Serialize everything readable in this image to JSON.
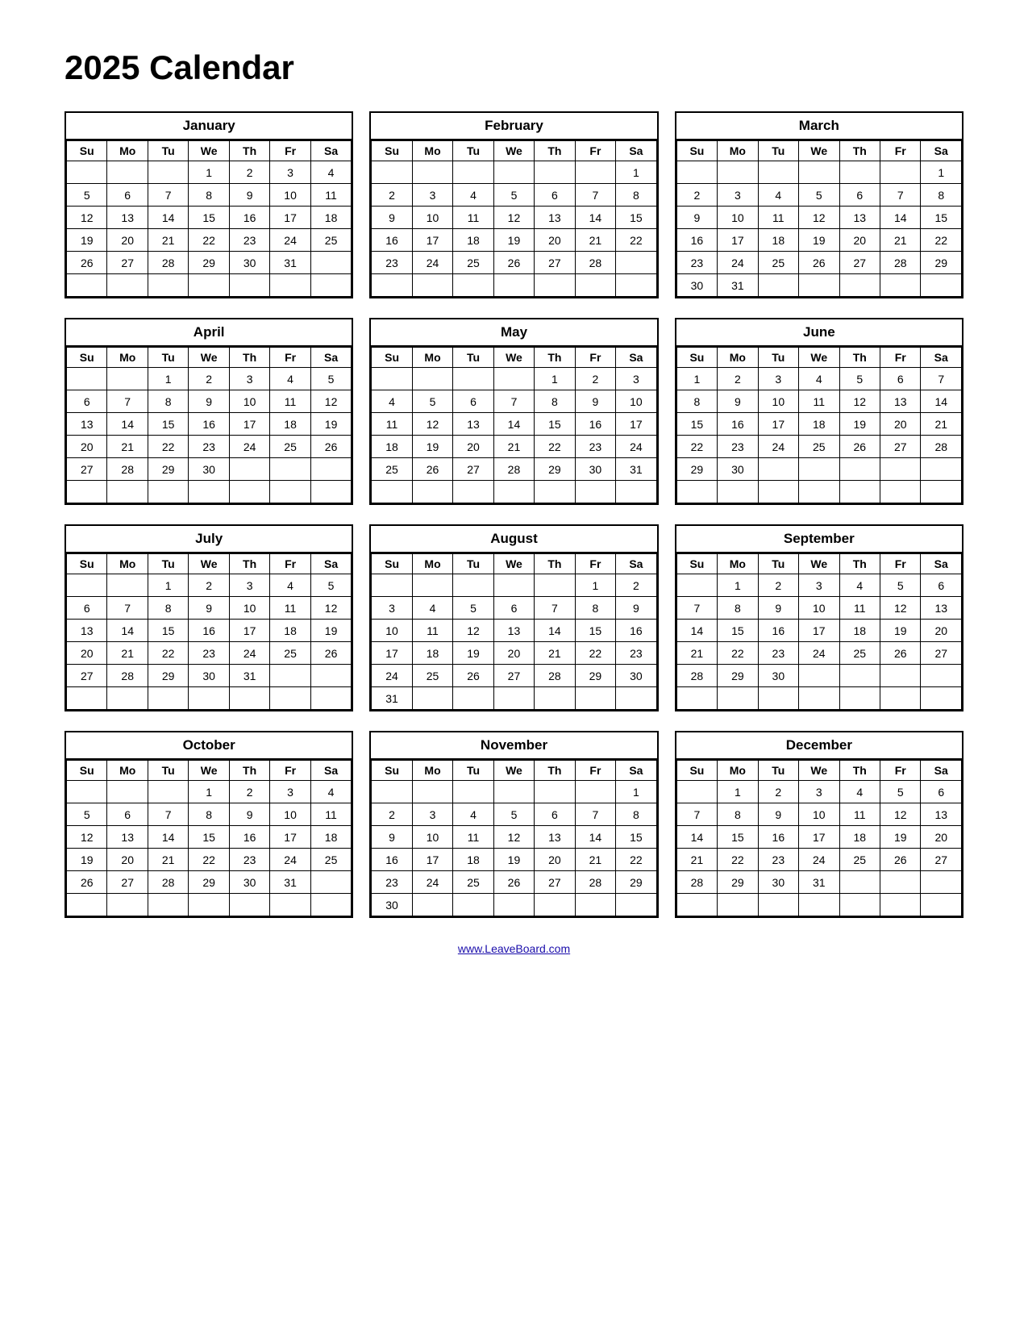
{
  "title": "2025 Calendar",
  "footer_link": "www.LeaveBoard.com",
  "months": [
    {
      "name": "January",
      "days": [
        "Su",
        "Mo",
        "Tu",
        "We",
        "Th",
        "Fr",
        "Sa"
      ],
      "weeks": [
        [
          "",
          "",
          "",
          "1",
          "2",
          "3",
          "4"
        ],
        [
          "5",
          "6",
          "7",
          "8",
          "9",
          "10",
          "11"
        ],
        [
          "12",
          "13",
          "14",
          "15",
          "16",
          "17",
          "18"
        ],
        [
          "19",
          "20",
          "21",
          "22",
          "23",
          "24",
          "25"
        ],
        [
          "26",
          "27",
          "28",
          "29",
          "30",
          "31",
          ""
        ],
        [
          "",
          "",
          "",
          "",
          "",
          "",
          ""
        ]
      ]
    },
    {
      "name": "February",
      "days": [
        "Su",
        "Mo",
        "Tu",
        "We",
        "Th",
        "Fr",
        "Sa"
      ],
      "weeks": [
        [
          "",
          "",
          "",
          "",
          "",
          "",
          "1"
        ],
        [
          "2",
          "3",
          "4",
          "5",
          "6",
          "7",
          "8"
        ],
        [
          "9",
          "10",
          "11",
          "12",
          "13",
          "14",
          "15"
        ],
        [
          "16",
          "17",
          "18",
          "19",
          "20",
          "21",
          "22"
        ],
        [
          "23",
          "24",
          "25",
          "26",
          "27",
          "28",
          ""
        ],
        [
          "",
          "",
          "",
          "",
          "",
          "",
          ""
        ]
      ]
    },
    {
      "name": "March",
      "days": [
        "Su",
        "Mo",
        "Tu",
        "We",
        "Th",
        "Fr",
        "Sa"
      ],
      "weeks": [
        [
          "",
          "",
          "",
          "",
          "",
          "",
          "1"
        ],
        [
          "2",
          "3",
          "4",
          "5",
          "6",
          "7",
          "8"
        ],
        [
          "9",
          "10",
          "11",
          "12",
          "13",
          "14",
          "15"
        ],
        [
          "16",
          "17",
          "18",
          "19",
          "20",
          "21",
          "22"
        ],
        [
          "23",
          "24",
          "25",
          "26",
          "27",
          "28",
          "29"
        ],
        [
          "30",
          "31",
          "",
          "",
          "",
          "",
          ""
        ]
      ]
    },
    {
      "name": "April",
      "days": [
        "Su",
        "Mo",
        "Tu",
        "We",
        "Th",
        "Fr",
        "Sa"
      ],
      "weeks": [
        [
          "",
          "",
          "1",
          "2",
          "3",
          "4",
          "5"
        ],
        [
          "6",
          "7",
          "8",
          "9",
          "10",
          "11",
          "12"
        ],
        [
          "13",
          "14",
          "15",
          "16",
          "17",
          "18",
          "19"
        ],
        [
          "20",
          "21",
          "22",
          "23",
          "24",
          "25",
          "26"
        ],
        [
          "27",
          "28",
          "29",
          "30",
          "",
          "",
          ""
        ],
        [
          "",
          "",
          "",
          "",
          "",
          "",
          ""
        ]
      ]
    },
    {
      "name": "May",
      "days": [
        "Su",
        "Mo",
        "Tu",
        "We",
        "Th",
        "Fr",
        "Sa"
      ],
      "weeks": [
        [
          "",
          "",
          "",
          "",
          "1",
          "2",
          "3"
        ],
        [
          "4",
          "5",
          "6",
          "7",
          "8",
          "9",
          "10"
        ],
        [
          "11",
          "12",
          "13",
          "14",
          "15",
          "16",
          "17"
        ],
        [
          "18",
          "19",
          "20",
          "21",
          "22",
          "23",
          "24"
        ],
        [
          "25",
          "26",
          "27",
          "28",
          "29",
          "30",
          "31"
        ],
        [
          "",
          "",
          "",
          "",
          "",
          "",
          ""
        ]
      ]
    },
    {
      "name": "June",
      "days": [
        "Su",
        "Mo",
        "Tu",
        "We",
        "Th",
        "Fr",
        "Sa"
      ],
      "weeks": [
        [
          "1",
          "2",
          "3",
          "4",
          "5",
          "6",
          "7"
        ],
        [
          "8",
          "9",
          "10",
          "11",
          "12",
          "13",
          "14"
        ],
        [
          "15",
          "16",
          "17",
          "18",
          "19",
          "20",
          "21"
        ],
        [
          "22",
          "23",
          "24",
          "25",
          "26",
          "27",
          "28"
        ],
        [
          "29",
          "30",
          "",
          "",
          "",
          "",
          ""
        ],
        [
          "",
          "",
          "",
          "",
          "",
          "",
          ""
        ]
      ]
    },
    {
      "name": "July",
      "days": [
        "Su",
        "Mo",
        "Tu",
        "We",
        "Th",
        "Fr",
        "Sa"
      ],
      "weeks": [
        [
          "",
          "",
          "1",
          "2",
          "3",
          "4",
          "5"
        ],
        [
          "6",
          "7",
          "8",
          "9",
          "10",
          "11",
          "12"
        ],
        [
          "13",
          "14",
          "15",
          "16",
          "17",
          "18",
          "19"
        ],
        [
          "20",
          "21",
          "22",
          "23",
          "24",
          "25",
          "26"
        ],
        [
          "27",
          "28",
          "29",
          "30",
          "31",
          "",
          ""
        ],
        [
          "",
          "",
          "",
          "",
          "",
          "",
          ""
        ]
      ]
    },
    {
      "name": "August",
      "days": [
        "Su",
        "Mo",
        "Tu",
        "We",
        "Th",
        "Fr",
        "Sa"
      ],
      "weeks": [
        [
          "",
          "",
          "",
          "",
          "",
          "1",
          "2"
        ],
        [
          "3",
          "4",
          "5",
          "6",
          "7",
          "8",
          "9"
        ],
        [
          "10",
          "11",
          "12",
          "13",
          "14",
          "15",
          "16"
        ],
        [
          "17",
          "18",
          "19",
          "20",
          "21",
          "22",
          "23"
        ],
        [
          "24",
          "25",
          "26",
          "27",
          "28",
          "29",
          "30"
        ],
        [
          "31",
          "",
          "",
          "",
          "",
          "",
          ""
        ]
      ]
    },
    {
      "name": "September",
      "days": [
        "Su",
        "Mo",
        "Tu",
        "We",
        "Th",
        "Fr",
        "Sa"
      ],
      "weeks": [
        [
          "",
          "1",
          "2",
          "3",
          "4",
          "5",
          "6"
        ],
        [
          "7",
          "8",
          "9",
          "10",
          "11",
          "12",
          "13"
        ],
        [
          "14",
          "15",
          "16",
          "17",
          "18",
          "19",
          "20"
        ],
        [
          "21",
          "22",
          "23",
          "24",
          "25",
          "26",
          "27"
        ],
        [
          "28",
          "29",
          "30",
          "",
          "",
          "",
          ""
        ],
        [
          "",
          "",
          "",
          "",
          "",
          "",
          ""
        ]
      ]
    },
    {
      "name": "October",
      "days": [
        "Su",
        "Mo",
        "Tu",
        "We",
        "Th",
        "Fr",
        "Sa"
      ],
      "weeks": [
        [
          "",
          "",
          "",
          "1",
          "2",
          "3",
          "4"
        ],
        [
          "5",
          "6",
          "7",
          "8",
          "9",
          "10",
          "11"
        ],
        [
          "12",
          "13",
          "14",
          "15",
          "16",
          "17",
          "18"
        ],
        [
          "19",
          "20",
          "21",
          "22",
          "23",
          "24",
          "25"
        ],
        [
          "26",
          "27",
          "28",
          "29",
          "30",
          "31",
          ""
        ],
        [
          "",
          "",
          "",
          "",
          "",
          "",
          ""
        ]
      ]
    },
    {
      "name": "November",
      "days": [
        "Su",
        "Mo",
        "Tu",
        "We",
        "Th",
        "Fr",
        "Sa"
      ],
      "weeks": [
        [
          "",
          "",
          "",
          "",
          "",
          "",
          "1"
        ],
        [
          "2",
          "3",
          "4",
          "5",
          "6",
          "7",
          "8"
        ],
        [
          "9",
          "10",
          "11",
          "12",
          "13",
          "14",
          "15"
        ],
        [
          "16",
          "17",
          "18",
          "19",
          "20",
          "21",
          "22"
        ],
        [
          "23",
          "24",
          "25",
          "26",
          "27",
          "28",
          "29"
        ],
        [
          "30",
          "",
          "",
          "",
          "",
          "",
          ""
        ]
      ]
    },
    {
      "name": "December",
      "days": [
        "Su",
        "Mo",
        "Tu",
        "We",
        "Th",
        "Fr",
        "Sa"
      ],
      "weeks": [
        [
          "",
          "1",
          "2",
          "3",
          "4",
          "5",
          "6"
        ],
        [
          "7",
          "8",
          "9",
          "10",
          "11",
          "12",
          "13"
        ],
        [
          "14",
          "15",
          "16",
          "17",
          "18",
          "19",
          "20"
        ],
        [
          "21",
          "22",
          "23",
          "24",
          "25",
          "26",
          "27"
        ],
        [
          "28",
          "29",
          "30",
          "31",
          "",
          "",
          ""
        ],
        [
          "",
          "",
          "",
          "",
          "",
          "",
          ""
        ]
      ]
    }
  ]
}
